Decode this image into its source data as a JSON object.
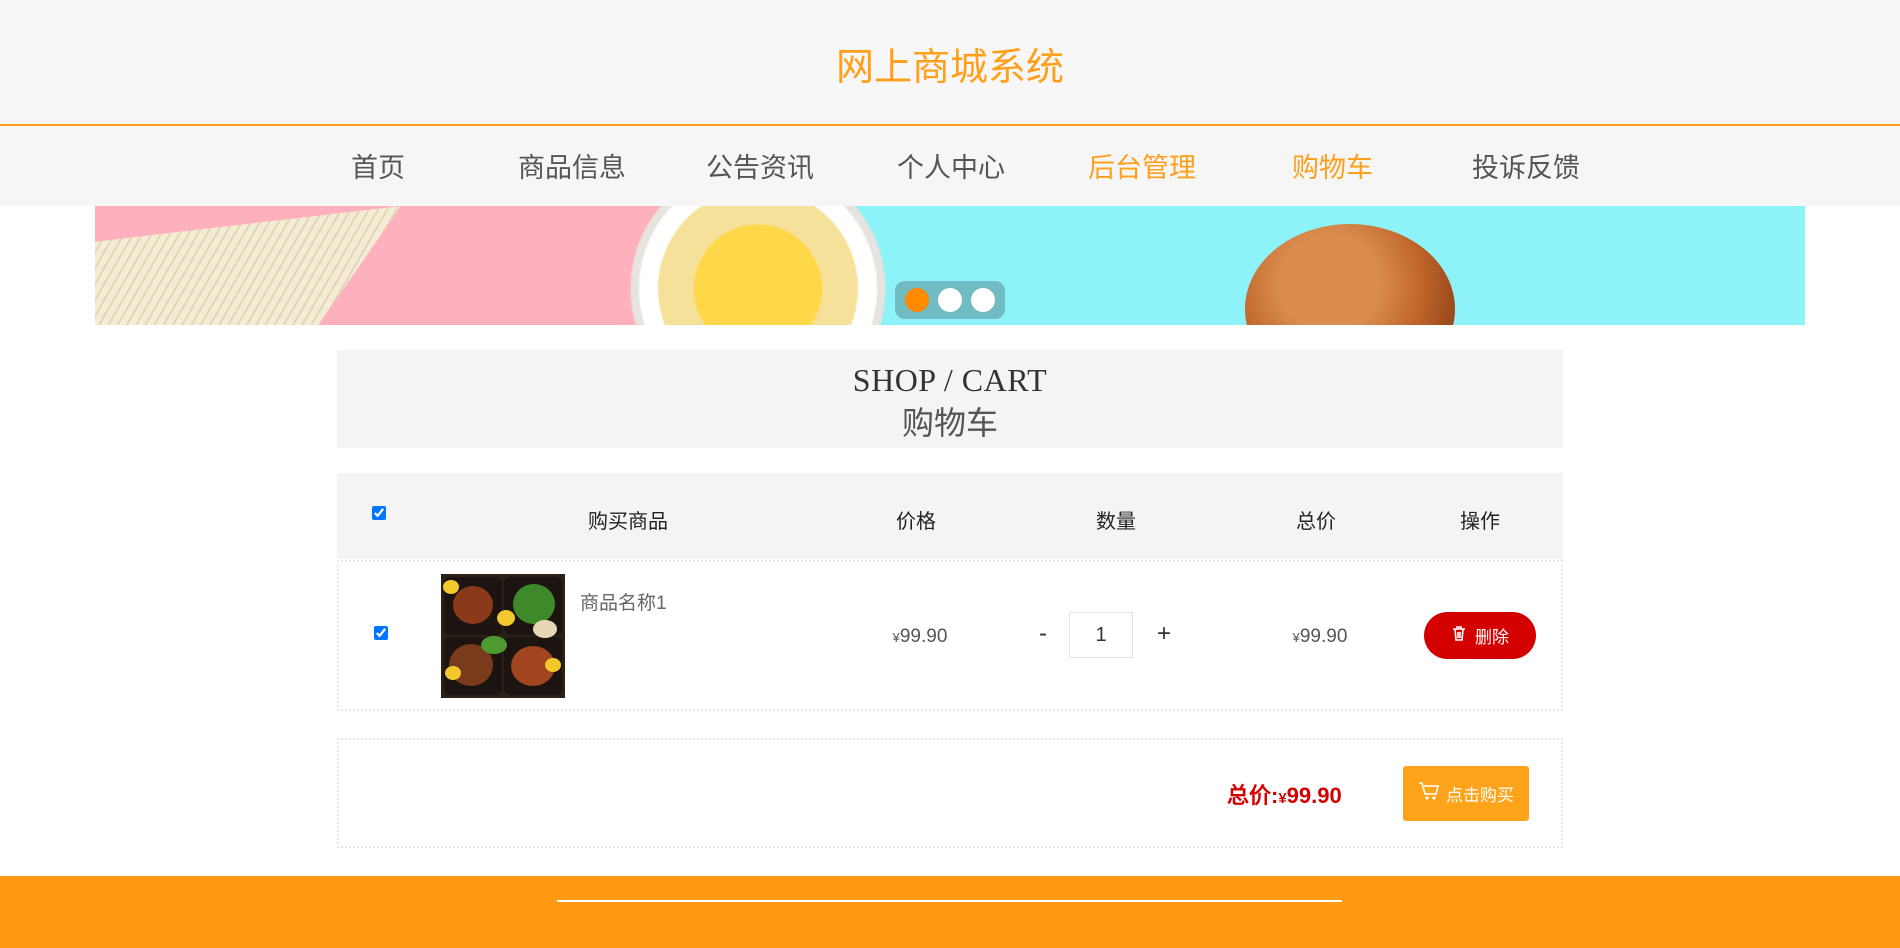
{
  "header": {
    "site_title": "网上商城系统"
  },
  "nav": {
    "items": [
      {
        "label": "首页",
        "active": false
      },
      {
        "label": "商品信息",
        "active": false
      },
      {
        "label": "公告资讯",
        "active": false
      },
      {
        "label": "个人中心",
        "active": false
      },
      {
        "label": "后台管理",
        "active": true
      },
      {
        "label": "购物车",
        "active": true
      },
      {
        "label": "投诉反馈",
        "active": false
      }
    ]
  },
  "carousel": {
    "slide_count": 3,
    "active_index": 0
  },
  "section": {
    "title_en": "SHOP / CART",
    "title_cn": "购物车"
  },
  "table": {
    "select_all_checked": true,
    "headers": [
      "购买商品",
      "价格",
      "数量",
      "总价",
      "操作"
    ],
    "rows": [
      {
        "checked": true,
        "product_name": "商品名称1",
        "image_icon": "food-bento-image",
        "currency": "¥",
        "price": "99.90",
        "quantity": "1",
        "minus": "-",
        "plus": "+",
        "subtotal": "99.90",
        "delete_label": "删除"
      }
    ]
  },
  "summary": {
    "total_label": "总价:",
    "currency": "¥",
    "total": "99.90",
    "buy_label": "点击购买"
  },
  "colors": {
    "accent": "#ff9f1a",
    "delete": "#d40000",
    "total_text": "#d40000",
    "footer": "#ff9a12"
  }
}
